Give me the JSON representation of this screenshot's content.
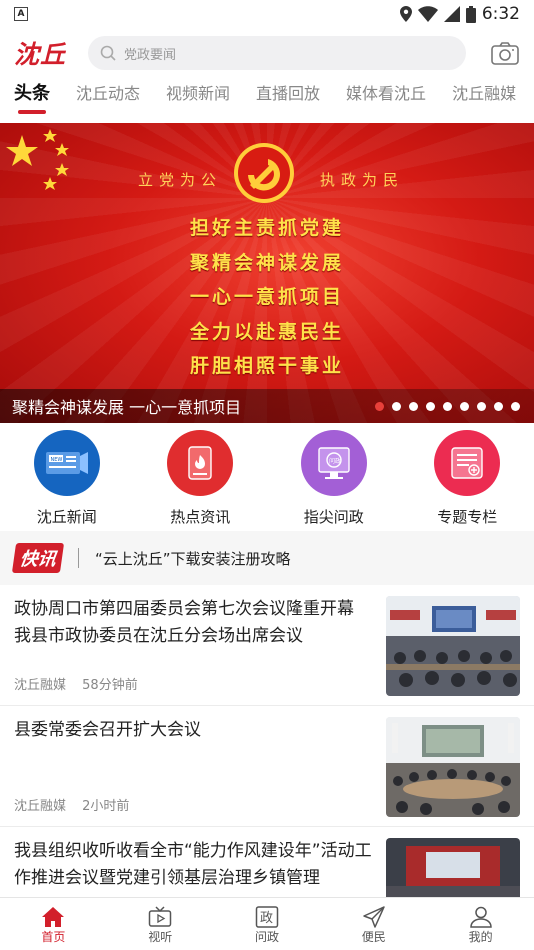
{
  "status": {
    "time": "6:32"
  },
  "header": {
    "logo": "沈丘",
    "search_placeholder": "党政要闻"
  },
  "tabs": [
    "头条",
    "沈丘动态",
    "视频新闻",
    "直播回放",
    "媒体看沈丘",
    "沈丘融媒"
  ],
  "banner": {
    "slogan_left": "立党为公",
    "slogan_right": "执政为民",
    "lines": [
      "担好主责抓党建",
      "聚精会神谋发展",
      "一心一意抓项目",
      "全力以赴惠民生",
      "肝胆相照干事业"
    ],
    "caption": "聚精会神谋发展 一心一意抓项目",
    "slide_count": 9,
    "active_slide": 1
  },
  "quick": [
    {
      "label": "沈丘新闻",
      "color": "#1565c0",
      "icon": "news-icon"
    },
    {
      "label": "热点资讯",
      "color": "#e02d2f",
      "icon": "hot-news-icon"
    },
    {
      "label": "指尖问政",
      "color": "#a35fd6",
      "icon": "ask-gov-icon"
    },
    {
      "label": "专题专栏",
      "color": "#ec2c51",
      "icon": "topic-icon"
    }
  ],
  "flash": {
    "badge": "快讯",
    "text": "“云上沈丘”下载安装注册攻略"
  },
  "news": [
    {
      "title": "政协周口市第四届委员会第七次会议隆重开幕 我县市政协委员在沈丘分会场出席会议",
      "source": "沈丘融媒",
      "time": "58分钟前"
    },
    {
      "title": "县委常委会召开扩大会议",
      "source": "沈丘融媒",
      "time": "2小时前"
    },
    {
      "title": "我县组织收听收看全市“能力作风建设年”活动工作推进会议暨党建引领基层治理乡镇管理",
      "source": "",
      "time": ""
    }
  ],
  "bottom_nav": [
    {
      "label": "首页",
      "icon": "home-icon",
      "active": true
    },
    {
      "label": "视听",
      "icon": "video-icon",
      "active": false
    },
    {
      "label": "问政",
      "icon": "gov-icon",
      "active": false
    },
    {
      "label": "便民",
      "icon": "send-icon",
      "active": false
    },
    {
      "label": "我的",
      "icon": "user-icon",
      "active": false
    }
  ],
  "colors": {
    "accent": "#d21f2b"
  }
}
